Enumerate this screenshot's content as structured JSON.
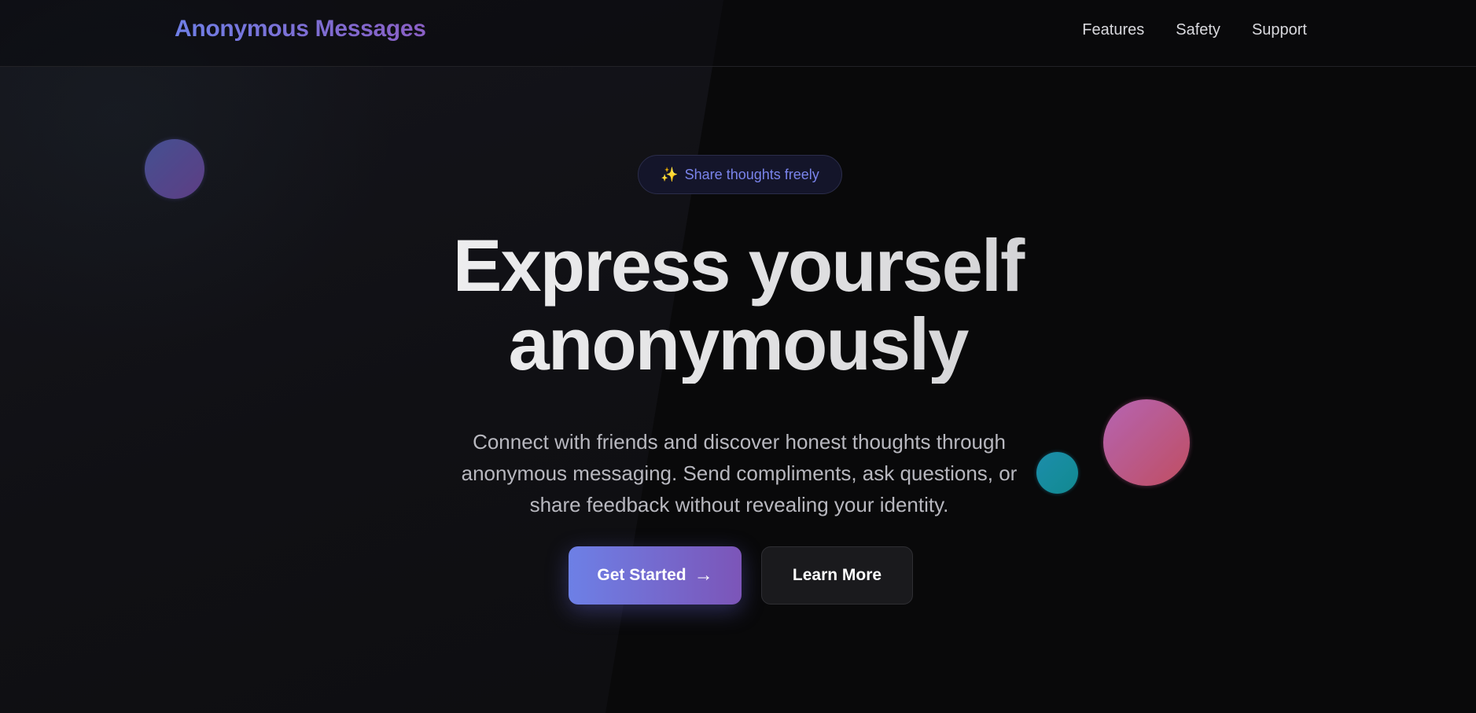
{
  "header": {
    "brand": "Anonymous Messages",
    "nav": [
      {
        "label": "Features"
      },
      {
        "label": "Safety"
      },
      {
        "label": "Support"
      }
    ]
  },
  "hero": {
    "badge": {
      "icon": "sparkles-icon",
      "icon_glyph": "✨",
      "text": "Share thoughts freely"
    },
    "headline_line1": "Express yourself",
    "headline_line2": "anonymously",
    "subtext": "Connect with friends and discover honest thoughts through anonymous messaging. Send compliments, ask questions, or share feedback without revealing your identity.",
    "primary_button": {
      "label": "Get Started",
      "arrow": "→"
    },
    "secondary_button": {
      "label": "Learn More"
    }
  },
  "colors": {
    "background": "#0a0a0b",
    "brand_gradient_start": "#6f7fe6",
    "brand_gradient_end": "#8a5fc4",
    "badge_text": "#7a84ec",
    "primary_button_start": "#6d80e6",
    "primary_button_end": "#7c55b8",
    "orb_pink": "#d4566b",
    "orb_cyan": "#1fa6c8",
    "orb_purple": "#6b4596"
  }
}
